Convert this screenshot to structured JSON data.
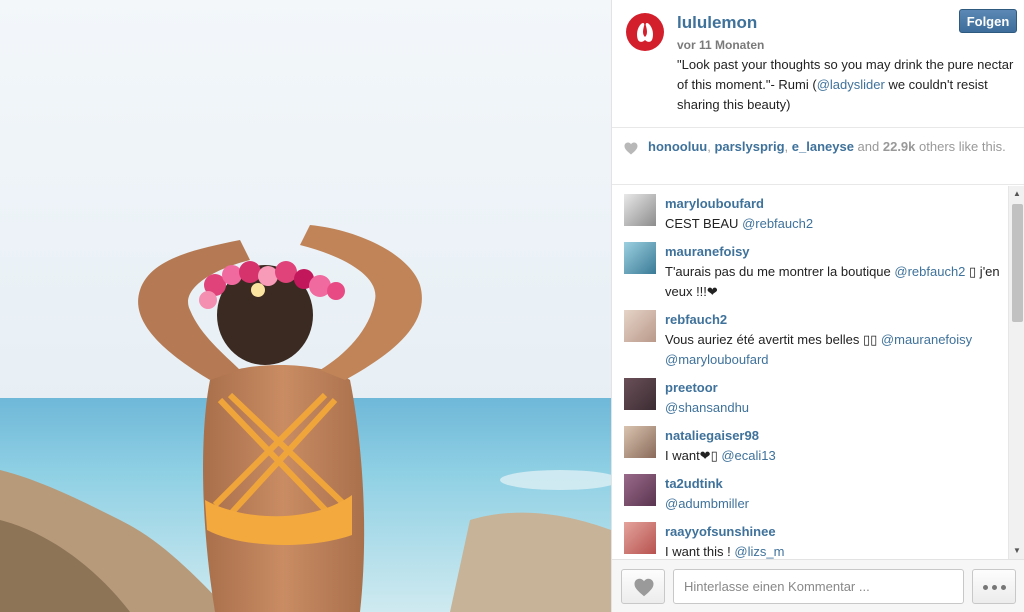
{
  "post": {
    "username": "lululemon",
    "follow_label": "Folgen",
    "time": "vor 11 Monaten",
    "caption_before": "\"Look past your thoughts so you may drink the pure nectar of this moment.\"- Rumi (",
    "caption_mention": "@ladyslider",
    "caption_after": " we couldn't resist sharing this beauty)"
  },
  "likes": {
    "users": [
      "honooluu",
      "parslysprig",
      "e_laneyse"
    ],
    "sep1": ", ",
    "sep2": ", ",
    "and_text": " and ",
    "count": "22.9k",
    "suffix": " others like this."
  },
  "comments": [
    {
      "user": "marylouboufard",
      "text": "CEST BEAU ",
      "mentions": [
        "@rebfauch2"
      ],
      "avatar_color": "#8c8c8c"
    },
    {
      "user": "mauranefoisy",
      "text": "T'aurais pas du me montrer la boutique ",
      "mentions": [
        "@rebfauch2"
      ],
      "tail": " ▯ j'en veux !!!❤",
      "avatar_color": "#3a7a96"
    },
    {
      "user": "rebfauch2",
      "text": "Vous auriez été avertit mes belles ▯▯ ",
      "mentions": [
        "@mauranefoisy",
        "@marylouboufard"
      ],
      "avatar_color": "#b9998a"
    },
    {
      "user": "preetoor",
      "text": "",
      "mentions": [
        "@shansandhu"
      ],
      "avatar_color": "#3c2c33"
    },
    {
      "user": "nataliegaiser98",
      "text": "I want❤▯ ",
      "mentions": [
        "@ecali13"
      ],
      "avatar_color": "#8a6a5a"
    },
    {
      "user": "ta2udtink",
      "text": "",
      "mentions": [
        "@adumbmiller"
      ],
      "avatar_color": "#5a3550"
    },
    {
      "user": "raayyofsunshinee",
      "text": "I want this ! ",
      "mentions": [
        "@lizs_m"
      ],
      "avatar_color": "#b7524f"
    }
  ],
  "footer": {
    "comment_placeholder": "Hinterlasse einen Kommentar ..."
  },
  "colors": {
    "link": "#3f729b",
    "follow_button": "#3e6d9b",
    "brand_red": "#d31f2c"
  },
  "icons": [
    "lululemon-logo-icon",
    "heart-icon",
    "more-dots-icon",
    "scroll-up-icon",
    "scroll-down-icon"
  ]
}
